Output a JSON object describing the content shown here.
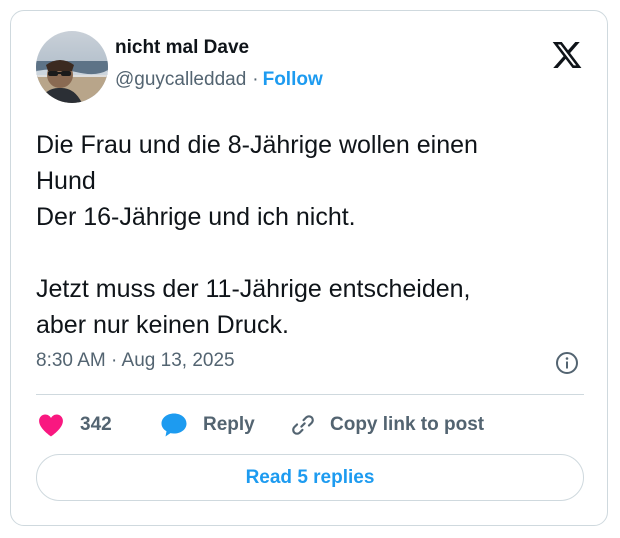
{
  "author": {
    "name": "nicht mal Dave",
    "handle": "@guycalleddad",
    "separator": "·",
    "follow_label": "Follow"
  },
  "tweet": {
    "text": "Die Frau und die 8-Jährige wollen einen\nHund\nDer 16-Jährige und ich nicht.\n\nJetzt muss der 11-Jährige entscheiden,\naber nur keinen Druck.",
    "timestamp": "8:30 AM · Aug 13, 2025"
  },
  "actions": {
    "likes_count": "342",
    "reply_label": "Reply",
    "copy_label": "Copy link to post"
  },
  "read_replies_label": "Read 5 replies",
  "icons": {
    "brand": "x-logo-icon",
    "info": "info-icon",
    "like": "heart-icon",
    "reply": "speech-bubble-icon",
    "copy": "link-icon"
  },
  "colors": {
    "accent": "#1d9bf0",
    "like": "#f91880",
    "text": "#0f1419",
    "muted": "#536471",
    "border": "#cfd9de"
  }
}
